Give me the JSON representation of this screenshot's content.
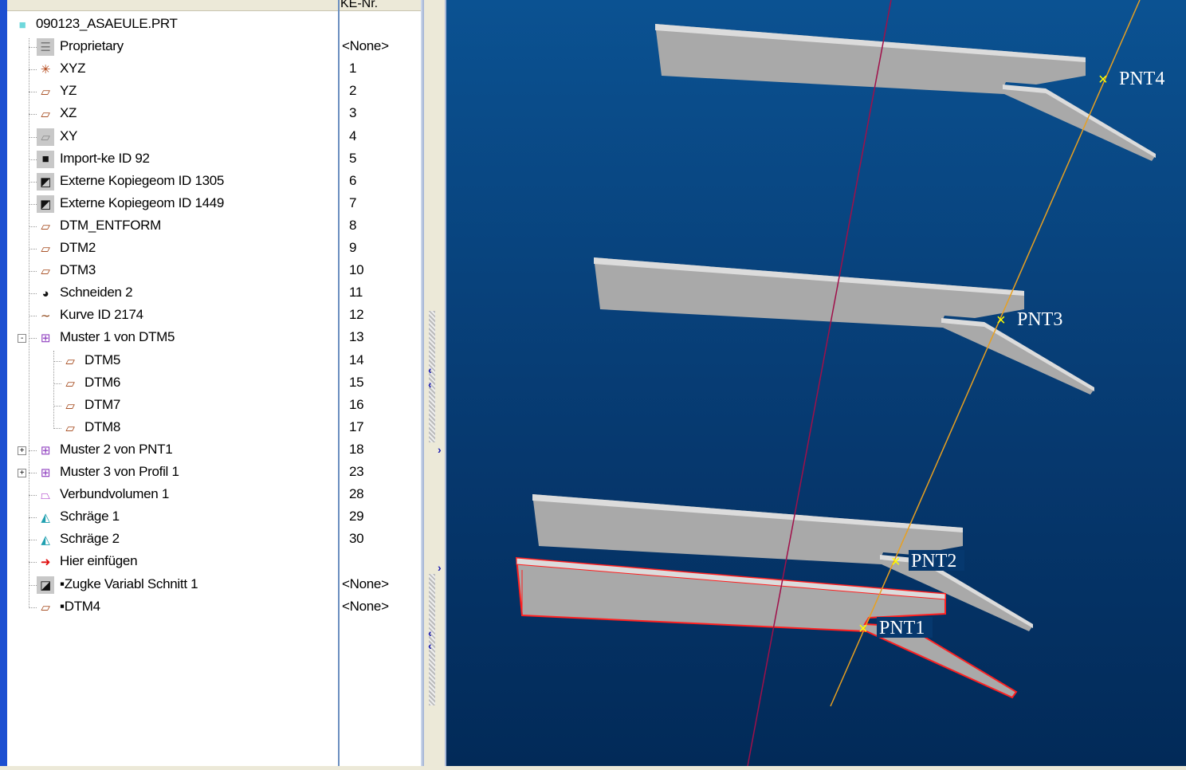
{
  "tree": {
    "column_header": "KE-Nr.",
    "items": [
      {
        "label": "090123_ASAEULE.PRT",
        "nr": "",
        "icon": "part-icon",
        "level": 0
      },
      {
        "label": "Proprietary",
        "nr": "<None>",
        "icon": "proprietary-icon",
        "level": 1
      },
      {
        "label": "XYZ",
        "nr": "1",
        "icon": "coordinate-system-icon",
        "level": 1
      },
      {
        "label": "YZ",
        "nr": "2",
        "icon": "datum-plane-icon",
        "level": 1
      },
      {
        "label": "XZ",
        "nr": "3",
        "icon": "datum-plane-icon",
        "level": 1
      },
      {
        "label": "XY",
        "nr": "4",
        "icon": "datum-plane-hidden-icon",
        "level": 1
      },
      {
        "label": "Import-ke ID 92",
        "nr": "5",
        "icon": "import-feature-icon",
        "level": 1
      },
      {
        "label": "Externe Kopiegeom ID 1305",
        "nr": "6",
        "icon": "external-copy-geom-icon",
        "level": 1
      },
      {
        "label": "Externe Kopiegeom ID 1449",
        "nr": "7",
        "icon": "external-copy-geom-icon",
        "level": 1
      },
      {
        "label": "DTM_ENTFORM",
        "nr": "8",
        "icon": "datum-plane-icon",
        "level": 1
      },
      {
        "label": "DTM2",
        "nr": "9",
        "icon": "datum-plane-icon",
        "level": 1
      },
      {
        "label": "DTM3",
        "nr": "10",
        "icon": "datum-plane-icon",
        "level": 1
      },
      {
        "label": "Schneiden 2",
        "nr": "11",
        "icon": "cut-icon",
        "level": 1
      },
      {
        "label": "Kurve ID 2174",
        "nr": "12",
        "icon": "curve-icon",
        "level": 1
      },
      {
        "label": "Muster 1 von DTM5",
        "nr": "13",
        "icon": "pattern-icon",
        "level": 1,
        "expander": "-"
      },
      {
        "label": "DTM5",
        "nr": "14",
        "icon": "datum-plane-icon",
        "level": 2
      },
      {
        "label": "DTM6",
        "nr": "15",
        "icon": "datum-plane-icon",
        "level": 2
      },
      {
        "label": "DTM7",
        "nr": "16",
        "icon": "datum-plane-icon",
        "level": 2
      },
      {
        "label": "DTM8",
        "nr": "17",
        "icon": "datum-plane-icon",
        "level": 2
      },
      {
        "label": "Muster 2 von PNT1",
        "nr": "18",
        "icon": "pattern-icon",
        "level": 1,
        "expander": "+"
      },
      {
        "label": "Muster 3 von Profil 1",
        "nr": "23",
        "icon": "pattern-icon",
        "level": 1,
        "expander": "+"
      },
      {
        "label": "Verbundvolumen 1",
        "nr": "28",
        "icon": "blend-icon",
        "level": 1
      },
      {
        "label": "Schräge 1",
        "nr": "29",
        "icon": "draft-icon",
        "level": 1
      },
      {
        "label": "Schräge 2",
        "nr": "30",
        "icon": "draft-icon",
        "level": 1
      },
      {
        "label": "Hier einfügen",
        "nr": "",
        "icon": "insert-here-arrow-icon",
        "level": 1
      },
      {
        "label": "▪Zugke Variabl Schnitt 1",
        "nr": "<None>",
        "icon": "variable-section-sweep-icon",
        "level": 1
      },
      {
        "label": "▪DTM4",
        "nr": "<None>",
        "icon": "datum-plane-icon",
        "level": 1
      }
    ]
  },
  "viewport": {
    "points": [
      "PNT4",
      "PNT3",
      "PNT2",
      "PNT1"
    ],
    "colors": {
      "bg_top": "#0b5292",
      "bg_bottom": "#022a58",
      "axis": "#a0104a",
      "curve": "#e8a020",
      "highlight": "#ff2020"
    }
  }
}
